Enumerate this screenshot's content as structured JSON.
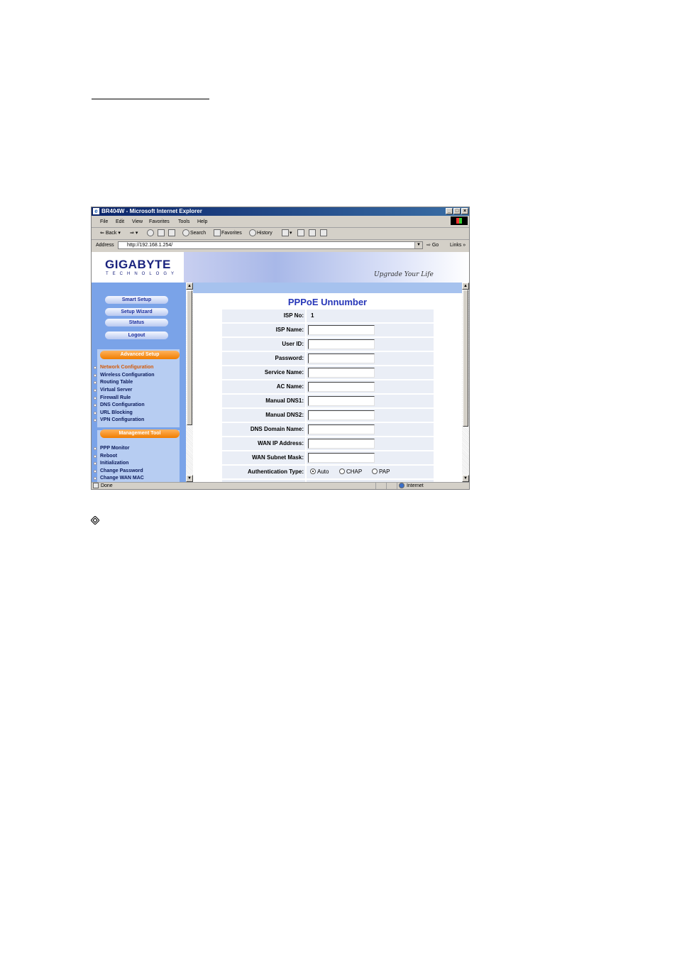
{
  "window": {
    "title": "BR404W - Microsoft Internet Explorer",
    "controls": {
      "minimize": "_",
      "maximize": "□",
      "close": "×"
    }
  },
  "menu": [
    "File",
    "Edit",
    "View",
    "Favorites",
    "Tools",
    "Help"
  ],
  "toolbar": {
    "back": "Back",
    "search": "Search",
    "favorites": "Favorites",
    "history": "History"
  },
  "address": {
    "label": "Address",
    "url": "http://192.168.1.254/",
    "go": "Go",
    "links": "Links"
  },
  "banner": {
    "logo": "GIGABYTE",
    "logo_sub": "TECHNOLOGY",
    "tagline": "Upgrade Your Life"
  },
  "sidebar": {
    "buttons": [
      "Smart Setup",
      "Setup Wizard",
      "Status",
      "Logout"
    ],
    "advanced_title": "Advanced Setup",
    "advanced_items": [
      "Network Configuration",
      "Wireless Configuration",
      "Routing Table",
      "Virtual Server",
      "Firewall Rule",
      "DNS Configuration",
      "URL Blocking",
      "VPN Configuration"
    ],
    "management_title": "Management Tool",
    "management_items": [
      "PPP Monitor",
      "Reboot",
      "Initialization",
      "Change Password",
      "Change WAN MAC"
    ]
  },
  "page": {
    "title": "PPPoE Unnumber",
    "isp_no_label": "ISP No:",
    "isp_no_value": "1",
    "fields": [
      {
        "label": "ISP Name:",
        "value": ""
      },
      {
        "label": "User ID:",
        "value": ""
      },
      {
        "label": "Password:",
        "value": ""
      },
      {
        "label": "Service Name:",
        "value": ""
      },
      {
        "label": "AC Name:",
        "value": ""
      },
      {
        "label": "Manual DNS1:",
        "value": ""
      },
      {
        "label": "Manual DNS2:",
        "value": ""
      },
      {
        "label": "DNS Domain Name:",
        "value": ""
      },
      {
        "label": "WAN IP Address:",
        "value": ""
      },
      {
        "label": "WAN Subnet Mask:",
        "value": ""
      }
    ],
    "auth_label": "Authentication Type:",
    "auth_options": [
      "Auto",
      "CHAP",
      "PAP"
    ],
    "auth_selected": "Auto"
  },
  "status": {
    "left": "Done",
    "zone": "Internet"
  },
  "icons": [
    "ie-icon",
    "back-icon",
    "forward-icon",
    "stop-icon",
    "refresh-icon",
    "home-icon",
    "search-icon",
    "favorites-icon",
    "history-icon",
    "mail-icon",
    "print-icon",
    "edit-icon",
    "discuss-icon",
    "globe-icon",
    "diamond-bullet-icon"
  ],
  "colors": {
    "sidebar_bg": "#7aa3e8",
    "title_blue": "#2636b8",
    "section_orange": "#f07d00",
    "active_link": "#d25a0a"
  }
}
